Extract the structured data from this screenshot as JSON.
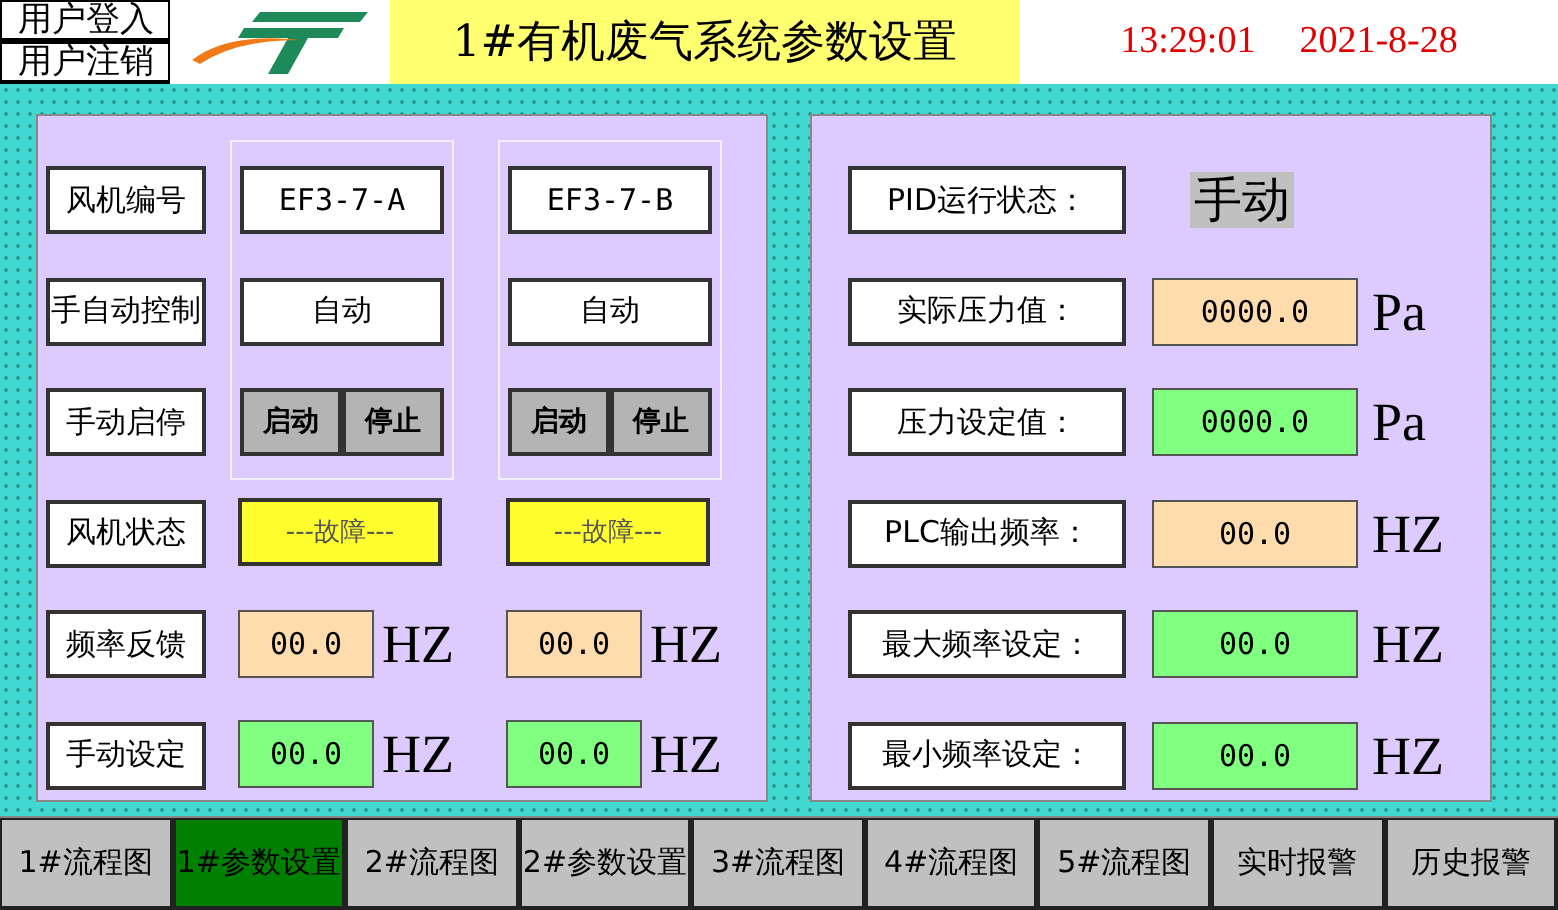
{
  "header": {
    "user_buttons": [
      "用户登入",
      "用户注销"
    ],
    "title": "1#有机废气系统参数设置",
    "time": "13:29:01",
    "date": "2021-8-28"
  },
  "fan_panel": {
    "row_labels": [
      "风机编号",
      "手自动控制",
      "手动启停",
      "风机状态",
      "频率反馈",
      "手动设定"
    ],
    "fans": [
      {
        "id": "EF3-7-A",
        "control_mode": "自动",
        "start_button": "启动",
        "stop_button": "停止",
        "status": "---故障---",
        "freq_feedback": "00.0",
        "freq_feedback_unit": "HZ",
        "manual_setting": "00.0",
        "manual_setting_unit": "HZ"
      },
      {
        "id": "EF3-7-B",
        "control_mode": "自动",
        "start_button": "启动",
        "stop_button": "停止",
        "status": "---故障---",
        "freq_feedback": "00.0",
        "freq_feedback_unit": "HZ",
        "manual_setting": "00.0",
        "manual_setting_unit": "HZ"
      }
    ]
  },
  "pid_panel": {
    "state_label": "PID运行状态：",
    "state": "手动",
    "rows": [
      {
        "label": "实际压力值：",
        "kind": "reading",
        "value": "0000.0",
        "unit": "Pa"
      },
      {
        "label": "压力设定值：",
        "kind": "setpoint",
        "value": "0000.0",
        "unit": "Pa"
      },
      {
        "label": "PLC输出频率：",
        "kind": "reading",
        "value": "00.0",
        "unit": "HZ"
      },
      {
        "label": "最大频率设定：",
        "kind": "setpoint",
        "value": "00.0",
        "unit": "HZ"
      },
      {
        "label": "最小频率设定：",
        "kind": "setpoint",
        "value": "00.0",
        "unit": "HZ"
      }
    ]
  },
  "nav_tabs": [
    {
      "label": "1#流程图",
      "selected": false
    },
    {
      "label": "1#参数设置",
      "selected": true
    },
    {
      "label": "2#流程图",
      "selected": false
    },
    {
      "label": "2#参数设置",
      "selected": false
    },
    {
      "label": "3#流程图",
      "selected": false
    },
    {
      "label": "4#流程图",
      "selected": false
    },
    {
      "label": "5#流程图",
      "selected": false
    },
    {
      "label": "实时报警",
      "selected": false
    },
    {
      "label": "历史报警",
      "selected": false
    }
  ]
}
